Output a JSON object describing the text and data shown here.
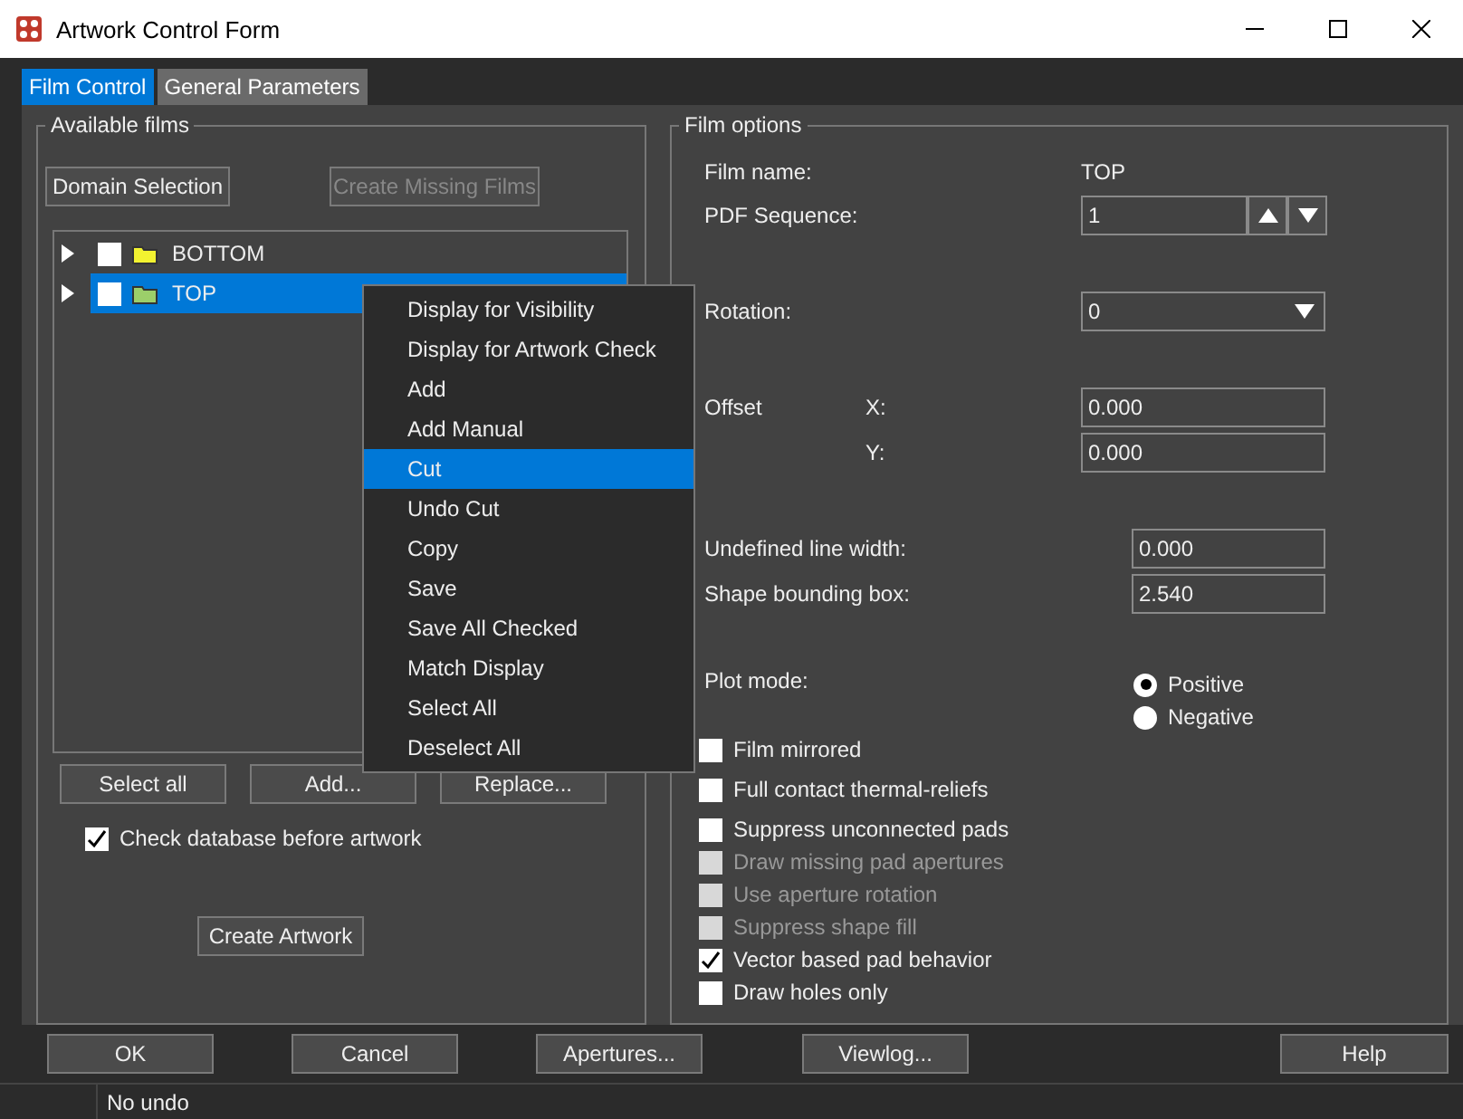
{
  "window": {
    "title": "Artwork Control Form"
  },
  "tabs": [
    {
      "label": "Film Control",
      "selected": true
    },
    {
      "label": "General Parameters",
      "selected": false
    }
  ],
  "available_films": {
    "title": "Available films",
    "top_buttons": [
      {
        "label": "Domain Selection",
        "disabled": false
      },
      {
        "label": "Create Missing Films",
        "disabled": true
      }
    ],
    "films": [
      {
        "name": "BOTTOM",
        "checked": false,
        "selected": false,
        "color": "#f2f230"
      },
      {
        "name": "TOP",
        "checked": false,
        "selected": true,
        "color": "#9ccf6a"
      }
    ],
    "list_buttons": [
      "Select all",
      "Add...",
      "Replace..."
    ],
    "check_database": {
      "label": "Check database before artwork",
      "checked": true
    },
    "create_button": "Create Artwork"
  },
  "film_options": {
    "title": "Film options",
    "film_name": {
      "label": "Film name:",
      "value": "TOP"
    },
    "pdf_sequence": {
      "label": "PDF Sequence:",
      "value": "1"
    },
    "rotation": {
      "label": "Rotation:",
      "value": "0"
    },
    "offset": {
      "label": "Offset",
      "x_label": "X:",
      "x_value": "0.000",
      "y_label": "Y:",
      "y_value": "0.000"
    },
    "undefined_line_width": {
      "label": "Undefined line width:",
      "value": "0.000"
    },
    "shape_bounding_box": {
      "label": "Shape bounding box:",
      "value": "2.540"
    },
    "plot_mode": {
      "label": "Plot mode:",
      "options": [
        {
          "label": "Positive",
          "selected": true
        },
        {
          "label": "Negative",
          "selected": false
        }
      ]
    },
    "checkboxes": [
      {
        "label": "Film mirrored",
        "checked": false,
        "disabled": false
      },
      {
        "label": "Full contact thermal-reliefs",
        "checked": false,
        "disabled": false
      },
      {
        "label": "Suppress unconnected pads",
        "checked": false,
        "disabled": false
      },
      {
        "label": "Draw missing pad apertures",
        "checked": false,
        "disabled": true
      },
      {
        "label": "Use aperture rotation",
        "checked": false,
        "disabled": true
      },
      {
        "label": "Suppress shape fill",
        "checked": false,
        "disabled": true
      },
      {
        "label": "Vector based pad behavior",
        "checked": true,
        "disabled": false
      },
      {
        "label": "Draw holes only",
        "checked": false,
        "disabled": false
      }
    ]
  },
  "context_menu": {
    "items": [
      {
        "label": "Display for Visibility",
        "selected": false
      },
      {
        "label": "Display for Artwork Check",
        "selected": false
      },
      {
        "label": "Add",
        "selected": false
      },
      {
        "label": "Add Manual",
        "selected": false
      },
      {
        "label": "Cut",
        "selected": true
      },
      {
        "label": "Undo Cut",
        "selected": false
      },
      {
        "label": "Copy",
        "selected": false
      },
      {
        "label": "Save",
        "selected": false
      },
      {
        "label": "Save All Checked",
        "selected": false
      },
      {
        "label": "Match Display",
        "selected": false
      },
      {
        "label": "Select All",
        "selected": false
      },
      {
        "label": "Deselect All",
        "selected": false
      }
    ]
  },
  "footer_buttons": [
    "OK",
    "Cancel",
    "Apertures...",
    "Viewlog...",
    "Help"
  ],
  "status_bar": {
    "message": "No undo"
  }
}
